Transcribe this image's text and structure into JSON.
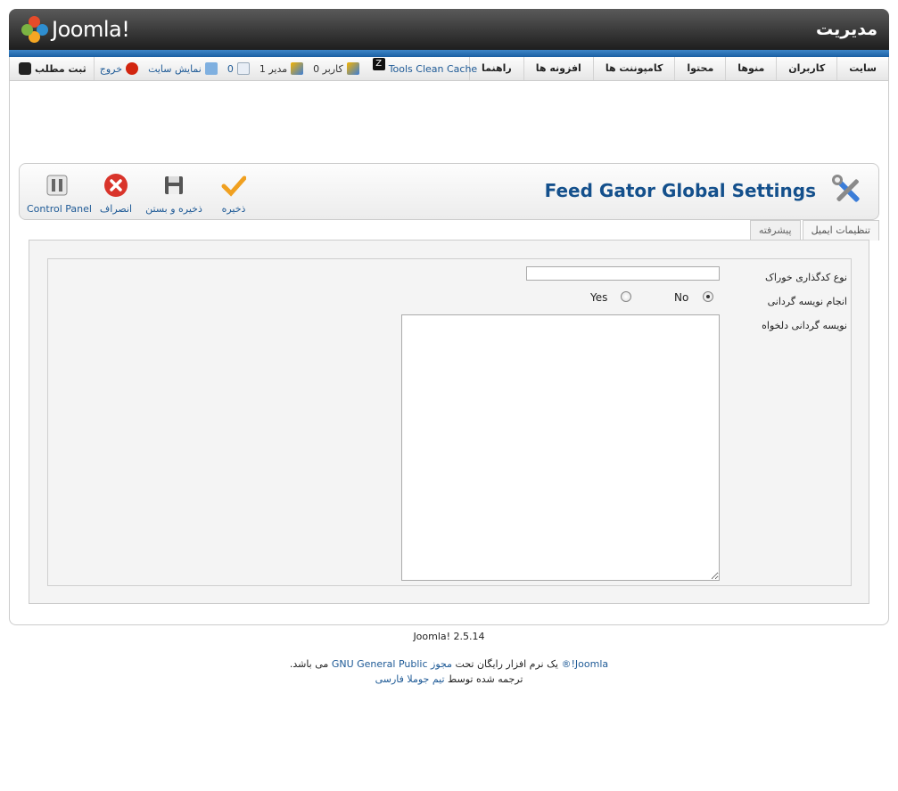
{
  "header": {
    "logo_text": "Joomla!",
    "admin_title": "مدیریت"
  },
  "main_menu": [
    {
      "label": "سایت"
    },
    {
      "label": "کاربران"
    },
    {
      "label": "منوها"
    },
    {
      "label": "محتوا"
    },
    {
      "label": "کامپوننت ها"
    },
    {
      "label": "افزونه ها"
    },
    {
      "label": "راهنما"
    }
  ],
  "status": {
    "clean_cache": "Tools Clean Cache",
    "users_count": "0",
    "users_label": "کاربر",
    "admins_count": "1",
    "admins_label": "مدیر",
    "messages_count": "0",
    "view_site": "نمایش سایت",
    "logout": "خروج",
    "write_post": "ثبت مطلب"
  },
  "toolbar": {
    "title": "Feed Gator Global Settings",
    "save": "ذخیره",
    "save_close": "ذخیره و بستن",
    "cancel": "انصراف",
    "control_panel": "Control Panel"
  },
  "tabs": [
    {
      "label": "تنظیمات ایمیل"
    },
    {
      "label": "پیشرفته"
    }
  ],
  "form": {
    "feed_encoding_label": "نوع کدگذاری خوراک",
    "feed_encoding_value": "",
    "transliteration_label": "انجام نویسه گردانی",
    "option_no": "No",
    "option_yes": "Yes",
    "selected": "No",
    "custom_translit_label": "نویسه گردانی دلخواه",
    "custom_translit_value": ""
  },
  "footer": {
    "version": "Joomla! 2.5.14",
    "joomla_link": "Joomla!®",
    "line1_mid": " یک نرم افزار رایگان تحت ",
    "license_prefix": "مجوز",
    "license_link": "GNU General Public",
    "line1_end": " می باشد.",
    "line2_prefix": "ترجمه شده توسط ",
    "translator_link": "تیم جوملا فارسی"
  }
}
